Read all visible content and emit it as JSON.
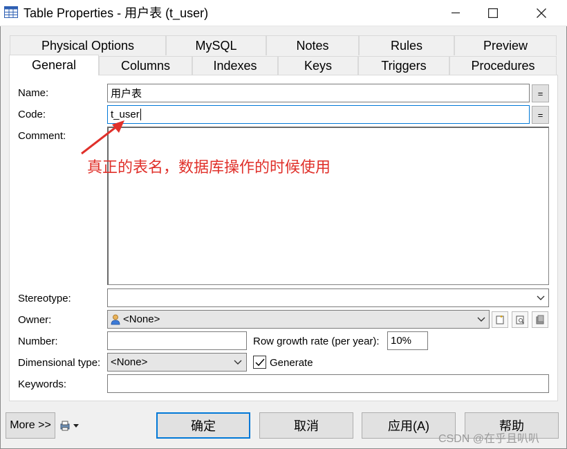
{
  "window": {
    "title": "Table Properties - 用户表 (t_user)",
    "minimize": "—",
    "maximize": "☐",
    "close": "✕"
  },
  "tabs": {
    "row1": [
      "Physical Options",
      "MySQL",
      "Notes",
      "Rules",
      "Preview"
    ],
    "row2": [
      "General",
      "Columns",
      "Indexes",
      "Keys",
      "Triggers",
      "Procedures"
    ],
    "active": "General"
  },
  "form": {
    "name_label": "Name:",
    "name_value": "用户表",
    "code_label": "Code:",
    "code_value": "t_user",
    "comment_label": "Comment:",
    "eq_label": "=",
    "stereotype_label": "Stereotype:",
    "owner_label": "Owner:",
    "owner_value": "<None>",
    "number_label": "Number:",
    "row_growth_label": "Row growth rate (per year):",
    "row_growth_value": "10%",
    "dimensional_label": "Dimensional type:",
    "dimensional_value": "<None>",
    "generate_label": "Generate",
    "generate_checked": true,
    "keywords_label": "Keywords:"
  },
  "annotation": {
    "text": "真正的表名，数据库操作的时候使用",
    "color": "#e0302a"
  },
  "buttons": {
    "more": "More >>",
    "ok": "确定",
    "cancel": "取消",
    "apply": "应用(A)",
    "help": "帮助"
  },
  "watermark": "CSDN @在乎且叭叭"
}
